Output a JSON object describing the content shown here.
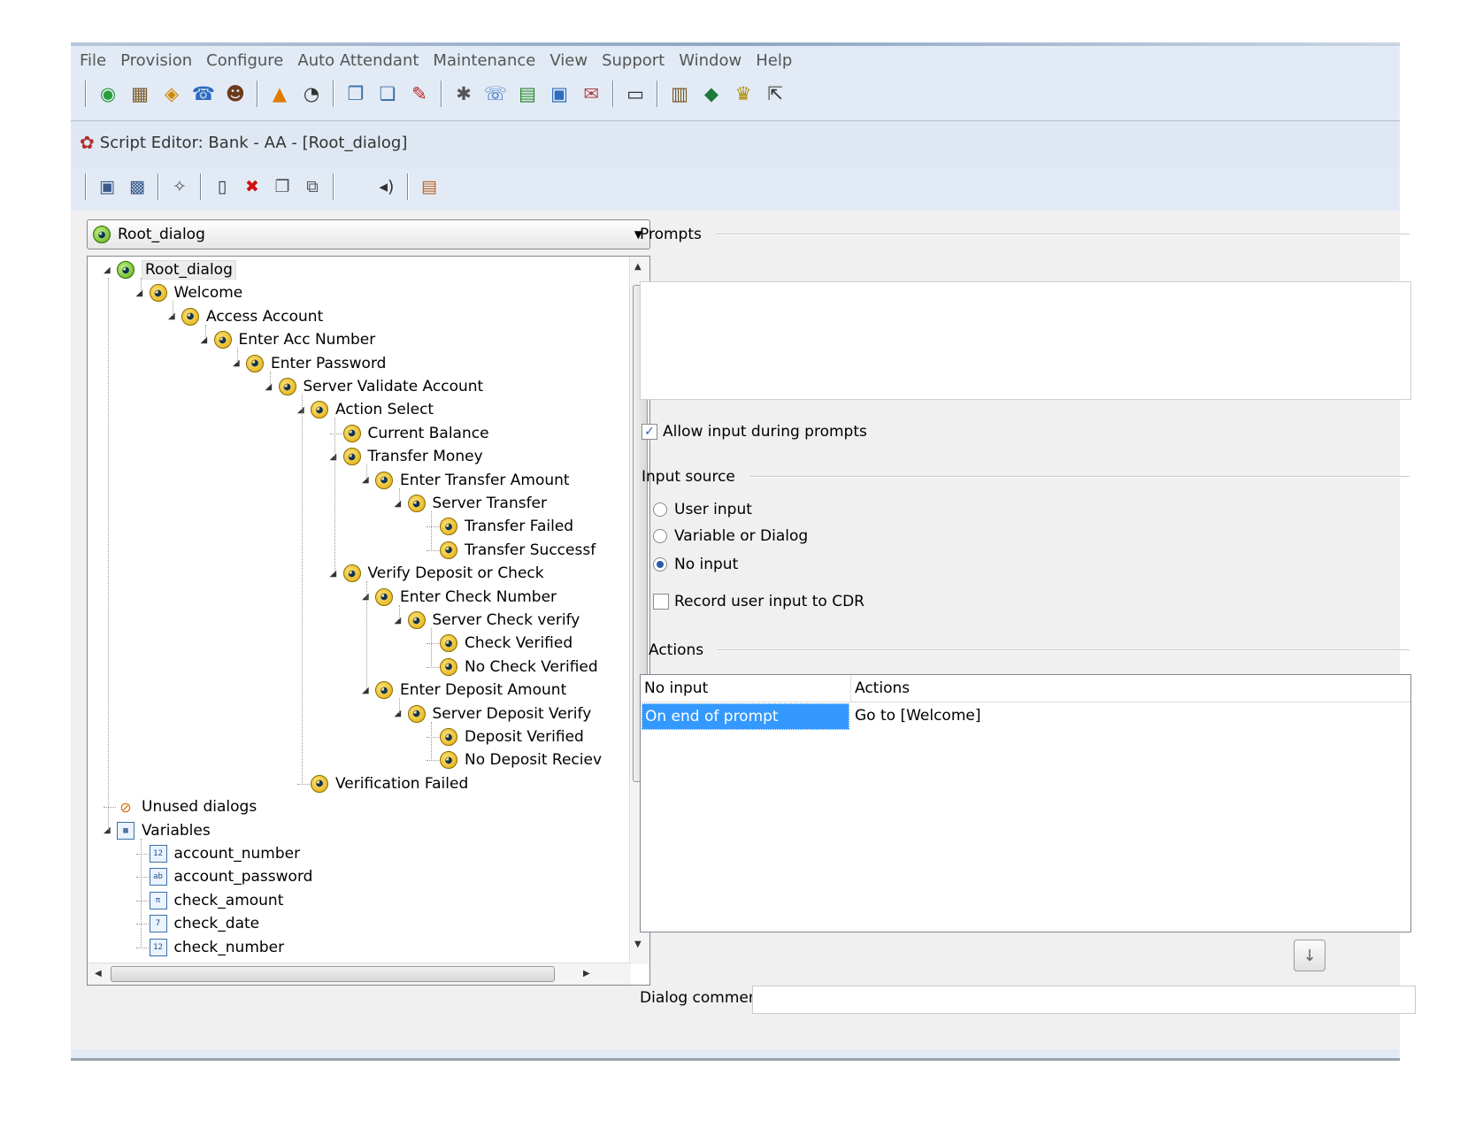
{
  "menu": [
    "File",
    "Provision",
    "Configure",
    "Auto Attendant",
    "Maintenance",
    "View",
    "Support",
    "Window",
    "Help"
  ],
  "main_toolbar_icons": [
    "globe-icon",
    "server-icon",
    "phone-line-icon",
    "phone-handset-icon",
    "agent-icon",
    "route-icon",
    "timer-icon",
    "copy-dialog-icon",
    "paste-dialog-icon",
    "wizard-icon",
    "tools-icon",
    "call-icon",
    "report-icon",
    "monitor-icon",
    "script-icon",
    "document-icon",
    "library-icon",
    "cube-icon",
    "license-icon",
    "help-pointer-icon"
  ],
  "editor": {
    "title": "Script Editor: Bank - AA - [Root_dialog]",
    "toolbar_icons": [
      "save-icon",
      "save-all-icon",
      "validate-icon",
      "new-icon",
      "delete-icon",
      "copy-icon",
      "paste-icon",
      "audio-icon",
      "notes-icon"
    ]
  },
  "dialog_selector": {
    "selected": "Root_dialog"
  },
  "tree": [
    {
      "label": "Root_dialog",
      "level": 0,
      "kind": "root",
      "expanded": true
    },
    {
      "label": "Welcome",
      "level": 1,
      "kind": "dialog",
      "expanded": true
    },
    {
      "label": "Access Account",
      "level": 2,
      "kind": "dialog",
      "expanded": true
    },
    {
      "label": "Enter Acc Number",
      "level": 3,
      "kind": "dialog",
      "expanded": true
    },
    {
      "label": "Enter Password",
      "level": 4,
      "kind": "dialog",
      "expanded": true
    },
    {
      "label": "Server Validate Account",
      "level": 5,
      "kind": "dialog",
      "expanded": true
    },
    {
      "label": "Action Select",
      "level": 6,
      "kind": "dialog",
      "expanded": true
    },
    {
      "label": "Current Balance",
      "level": 7,
      "kind": "dialog",
      "expanded": false
    },
    {
      "label": "Transfer Money",
      "level": 7,
      "kind": "dialog",
      "expanded": true
    },
    {
      "label": "Enter Transfer Amount",
      "level": 8,
      "kind": "dialog",
      "expanded": true
    },
    {
      "label": "Server Transfer",
      "level": 9,
      "kind": "dialog",
      "expanded": true
    },
    {
      "label": "Transfer Failed",
      "level": 10,
      "kind": "dialog",
      "expanded": false
    },
    {
      "label": "Transfer Successf",
      "level": 10,
      "kind": "dialog",
      "expanded": false
    },
    {
      "label": "Verify Deposit or Check",
      "level": 7,
      "kind": "dialog",
      "expanded": true
    },
    {
      "label": "Enter Check Number",
      "level": 8,
      "kind": "dialog",
      "expanded": true
    },
    {
      "label": "Server Check verify",
      "level": 9,
      "kind": "dialog",
      "expanded": true
    },
    {
      "label": "Check Verified",
      "level": 10,
      "kind": "dialog",
      "expanded": false
    },
    {
      "label": "No Check Verified",
      "level": 10,
      "kind": "dialog",
      "expanded": false
    },
    {
      "label": "Enter Deposit Amount",
      "level": 8,
      "kind": "dialog",
      "expanded": true
    },
    {
      "label": "Server Deposit Verify",
      "level": 9,
      "kind": "dialog",
      "expanded": true
    },
    {
      "label": "Deposit Verified",
      "level": 10,
      "kind": "dialog",
      "expanded": false
    },
    {
      "label": "No Deposit Reciev",
      "level": 10,
      "kind": "dialog",
      "expanded": false
    },
    {
      "label": "Verification Failed",
      "level": 6,
      "kind": "dialog",
      "expanded": false
    },
    {
      "label": "Unused dialogs",
      "level": 0,
      "kind": "unused",
      "expanded": false
    },
    {
      "label": "Variables",
      "level": 0,
      "kind": "variables",
      "expanded": true
    },
    {
      "label": "account_number",
      "level": 1,
      "kind": "var",
      "badge": "12"
    },
    {
      "label": "account_password",
      "level": 1,
      "kind": "var",
      "badge": "ab"
    },
    {
      "label": "check_amount",
      "level": 1,
      "kind": "var",
      "badge": "π"
    },
    {
      "label": "check_date",
      "level": 1,
      "kind": "var",
      "badge": "7"
    },
    {
      "label": "check_number",
      "level": 1,
      "kind": "var",
      "badge": "12"
    }
  ],
  "prompts": {
    "label": "Prompts"
  },
  "allow_input": {
    "label": "Allow input during prompts",
    "checked": true
  },
  "input_source": {
    "label": "Input source",
    "options": [
      "User input",
      "Variable or Dialog",
      "No input"
    ],
    "selected": "No input"
  },
  "record_cdr": {
    "label": "Record user input to CDR",
    "checked": false
  },
  "actions": {
    "label": "Actions",
    "columns": [
      "No input",
      "Actions"
    ],
    "rows": [
      {
        "event": "On end of prompt",
        "action": "Go to [Welcome]"
      }
    ]
  },
  "dialog_comment": {
    "label": "Dialog comment",
    "value": ""
  },
  "colors": {
    "selection": "#3399ff",
    "frame": "#e2ebf5"
  }
}
